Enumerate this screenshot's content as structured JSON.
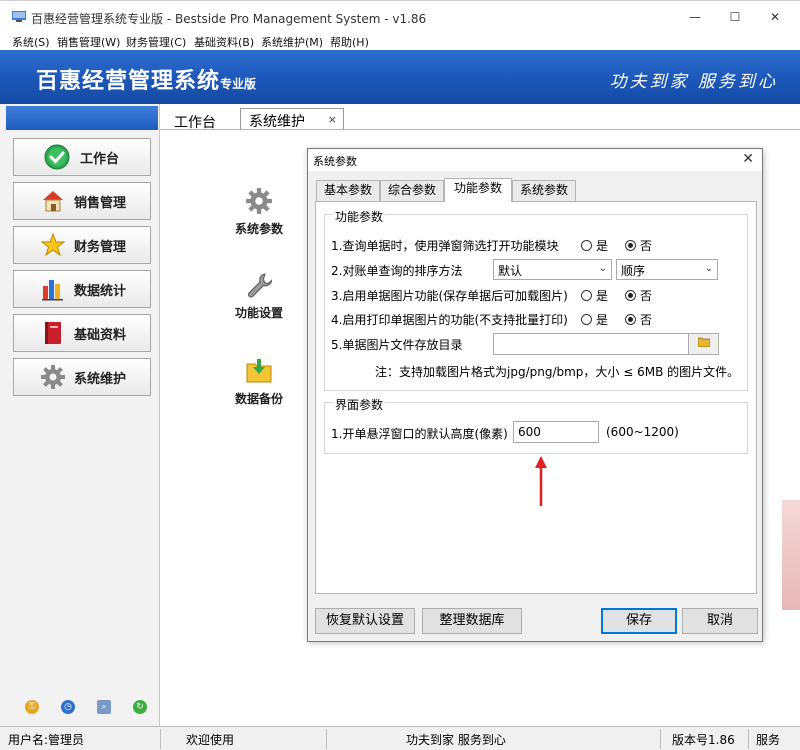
{
  "window": {
    "title": "百惠经营管理系统专业版 - Bestside Pro Management System - v1.86",
    "minimize_glyph": "—",
    "maximize_glyph": "☐",
    "close_glyph": "✕"
  },
  "menu": [
    "系统(S)",
    "销售管理(W)",
    "财务管理(C)",
    "基础资料(B)",
    "系统维护(M)",
    "帮助(H)"
  ],
  "banner": {
    "title": "百惠经营管理系统",
    "edition": "专业版",
    "slogan": "功夫到家 服务到心"
  },
  "sidebar": {
    "items": [
      {
        "label": "工作台",
        "icon": "check-circle-icon"
      },
      {
        "label": "销售管理",
        "icon": "house-icon"
      },
      {
        "label": "财务管理",
        "icon": "star-icon"
      },
      {
        "label": "数据统计",
        "icon": "bar-chart-icon"
      },
      {
        "label": "基础资料",
        "icon": "book-icon"
      },
      {
        "label": "系统维护",
        "icon": "gear-icon"
      }
    ],
    "bottom_icons": [
      "key-icon",
      "clock-icon",
      "search-window-icon",
      "refresh-icon"
    ]
  },
  "tabs": {
    "workbench": "工作台",
    "active": "系统维护",
    "close_glyph": "×"
  },
  "features": [
    {
      "label": "系统参数",
      "icon": "gear-icon"
    },
    {
      "label": "功能设置",
      "icon": "wrench-icon"
    },
    {
      "label": "数据备份",
      "icon": "folder-download-icon"
    }
  ],
  "dialog": {
    "title": "系统参数",
    "close_glyph": "✕",
    "tabs": [
      "基本参数",
      "综合参数",
      "功能参数",
      "系统参数"
    ],
    "active_tab": "功能参数",
    "function_group": {
      "title": "功能参数",
      "rows": {
        "q1": "1.查询单据时，使用弹窗筛选打开功能模块",
        "q2": "2.对账单查询的排序方法",
        "q3": "3.启用单据图片功能(保存单据后可加载图片)",
        "q4": "4.启用打印单据图片的功能(不支持批量打印)",
        "q5": "5.单据图片文件存放目录"
      },
      "yes": "是",
      "no": "否",
      "sort_field": "默认",
      "sort_order": "顺序",
      "dir_value": "",
      "note": "注：支持加载图片格式为jpg/png/bmp，大小 ≤ 6MB 的图片文件。"
    },
    "ui_group": {
      "title": "界面参数",
      "row_label": "1.开单悬浮窗口的默认高度(像素)",
      "height_value": "600",
      "range_hint": "(600~1200)"
    },
    "buttons": {
      "restore": "恢复默认设置",
      "tidy": "整理数据库",
      "save": "保存",
      "cancel": "取消"
    }
  },
  "status": {
    "user": "用户名:管理员",
    "welcome": "欢迎使用",
    "slogan": "功夫到家 服务到心",
    "version": "版本号1.86",
    "service": "服务"
  },
  "colors": {
    "banner": "#1c57b8",
    "annotation_arrow": "#e02020",
    "ok_green": "#2fa84f"
  }
}
